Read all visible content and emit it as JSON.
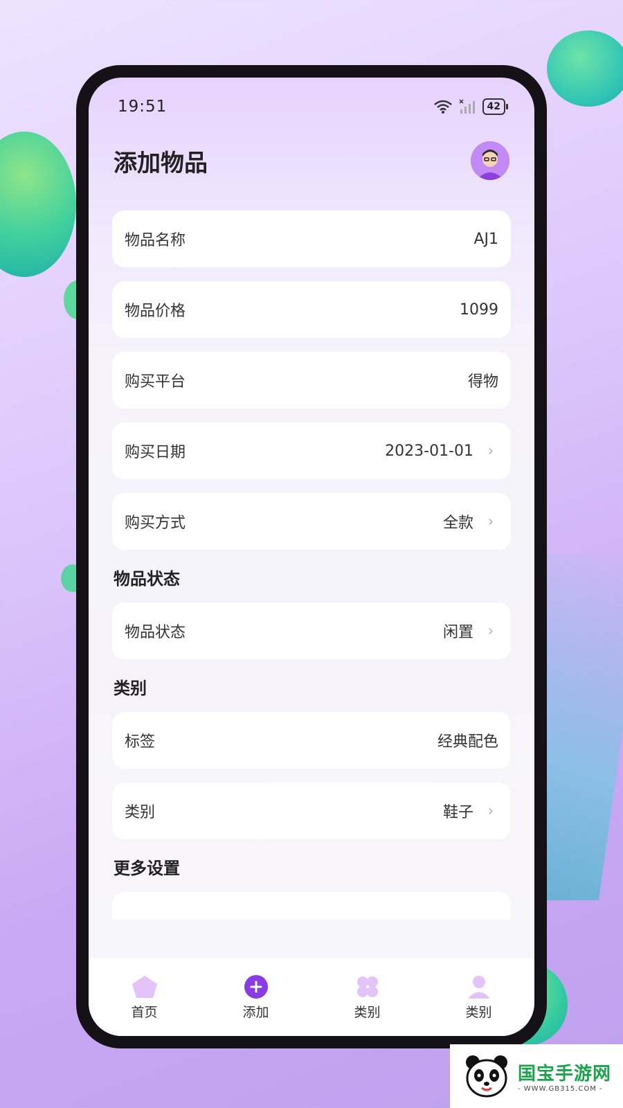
{
  "status_bar": {
    "time": "19:51",
    "battery": "42"
  },
  "header": {
    "title": "添加物品"
  },
  "rows_top": [
    {
      "label": "物品名称",
      "value": "AJ1"
    },
    {
      "label": "物品价格",
      "value": "1099"
    },
    {
      "label": "购买平台",
      "value": "得物"
    },
    {
      "label": "购买日期",
      "value": "2023-01-01"
    },
    {
      "label": "购买方式",
      "value": "全款"
    }
  ],
  "section_status": {
    "title": "物品状态",
    "row": {
      "label": "物品状态",
      "value": "闲置"
    }
  },
  "section_category": {
    "title": "类别",
    "rows": [
      {
        "label": "标签",
        "value": "经典配色"
      },
      {
        "label": "类别",
        "value": "鞋子"
      }
    ]
  },
  "section_more": {
    "title": "更多设置"
  },
  "tabbar": [
    {
      "label": "首页",
      "icon": "home-pentagon-icon"
    },
    {
      "label": "添加",
      "icon": "plus-circle-icon"
    },
    {
      "label": "类别",
      "icon": "grid-petals-icon"
    },
    {
      "label": "类别",
      "icon": "person-icon"
    }
  ],
  "watermark": {
    "main": "国宝手游网",
    "sub": "- WWW.GB315.COM -"
  },
  "colors": {
    "accent": "#8a3be6",
    "tab_icon": "#e4c4f8"
  }
}
